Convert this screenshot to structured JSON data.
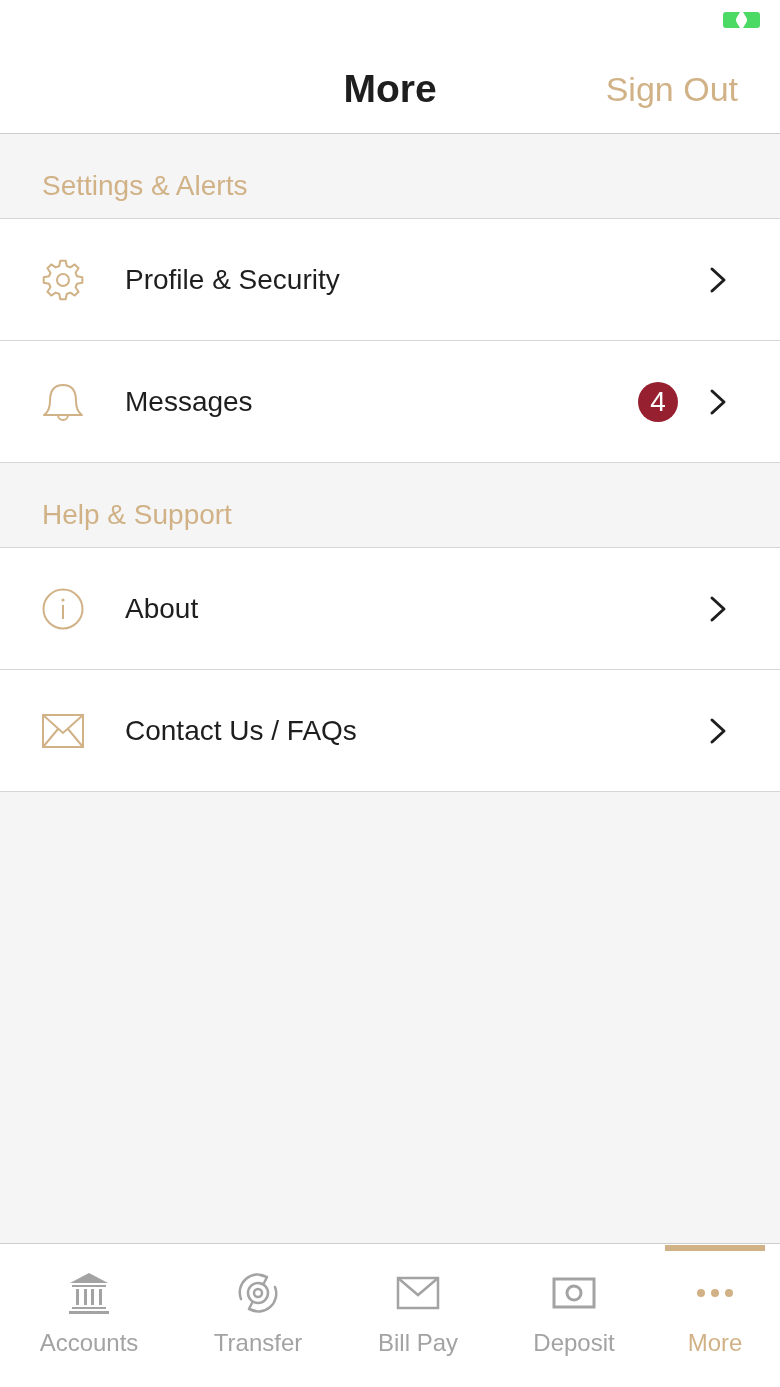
{
  "header": {
    "title": "More",
    "action": "Sign Out"
  },
  "sections": [
    {
      "title": "Settings & Alerts",
      "items": [
        {
          "label": "Profile & Security"
        },
        {
          "label": "Messages",
          "badge": "4"
        }
      ]
    },
    {
      "title": "Help & Support",
      "items": [
        {
          "label": "About"
        },
        {
          "label": "Contact Us / FAQs"
        }
      ]
    }
  ],
  "tab_bar": [
    {
      "label": "Accounts",
      "selected": false
    },
    {
      "label": "Transfer",
      "selected": false
    },
    {
      "label": "Bill Pay",
      "selected": false
    },
    {
      "label": "Deposit",
      "selected": false
    },
    {
      "label": "More",
      "selected": true
    }
  ]
}
